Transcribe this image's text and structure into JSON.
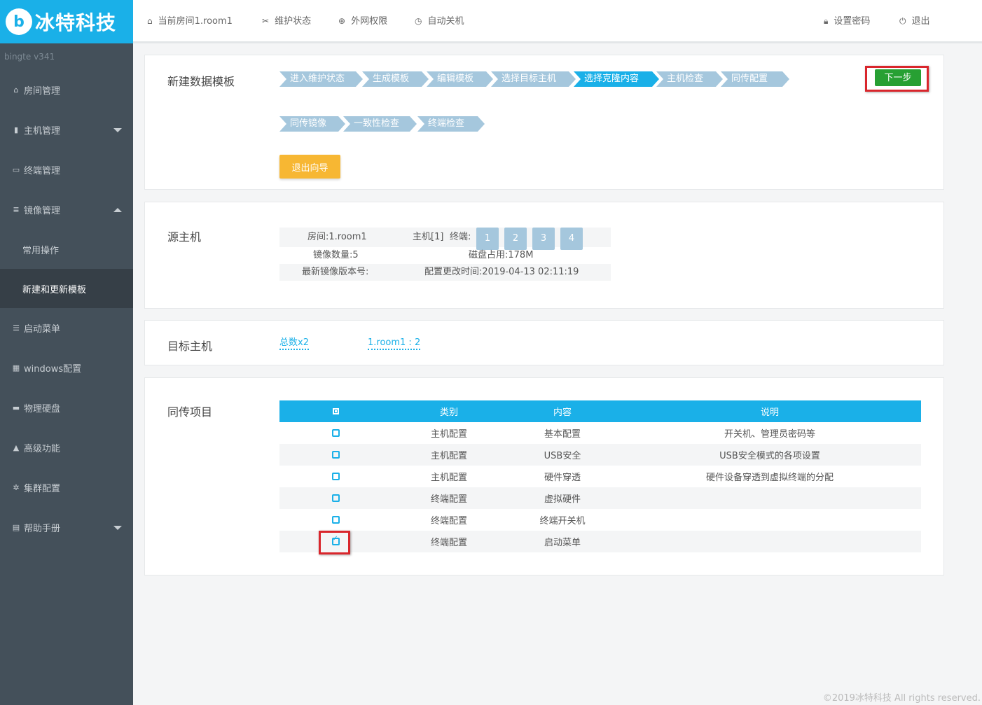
{
  "brand": {
    "logo_letter": "b",
    "name": "冰特科技",
    "version": "bingte  v341",
    "color": "#1ab0e8"
  },
  "sidebar": {
    "items": [
      {
        "label": "房间管理",
        "icon": "home-icon",
        "glyph": "⌂"
      },
      {
        "label": "主机管理",
        "icon": "server-icon",
        "glyph": "▮",
        "caret": "down"
      },
      {
        "label": "终端管理",
        "icon": "monitor-icon",
        "glyph": "▭"
      },
      {
        "label": "镜像管理",
        "icon": "database-icon",
        "glyph": "≣",
        "caret": "up"
      },
      {
        "label": "常用操作",
        "sub": true
      },
      {
        "label": "新建和更新模板",
        "sub": true,
        "active": true
      },
      {
        "label": "启动菜单",
        "icon": "list-icon",
        "glyph": "☰"
      },
      {
        "label": "windows配置",
        "icon": "windows-icon",
        "glyph": "▦"
      },
      {
        "label": "物理硬盘",
        "icon": "hdd-icon",
        "glyph": "▬"
      },
      {
        "label": "高级功能",
        "icon": "warning-icon",
        "glyph": "▲"
      },
      {
        "label": "集群配置",
        "icon": "gear-icon",
        "glyph": "✲"
      },
      {
        "label": "帮助手册",
        "icon": "book-icon",
        "glyph": "▤",
        "caret": "down"
      }
    ]
  },
  "topbar": {
    "room": {
      "label": "当前房间1.room1",
      "glyph": "⌂"
    },
    "maintain": {
      "label": "维护状态",
      "glyph": "✂"
    },
    "network": {
      "label": "外网权限",
      "glyph": "⊕"
    },
    "shutdown": {
      "label": "自动关机",
      "glyph": "◷"
    },
    "password": {
      "label": "设置密码",
      "glyph": "🔒︎"
    },
    "logout": {
      "label": "退出",
      "glyph": "⏻"
    }
  },
  "wizard": {
    "title": "新建数据模板",
    "steps_row1": [
      {
        "label": "进入维护状态",
        "active": false
      },
      {
        "label": "生成模板",
        "active": false
      },
      {
        "label": "编辑模板",
        "active": false
      },
      {
        "label": "选择目标主机",
        "active": false
      },
      {
        "label": "选择克隆内容",
        "active": true
      },
      {
        "label": "主机检查",
        "active": false
      },
      {
        "label": "同传配置",
        "active": false
      }
    ],
    "steps_row2": [
      {
        "label": "同传镜像",
        "active": false
      },
      {
        "label": "一致性检查",
        "active": false
      },
      {
        "label": "终端检查",
        "active": false
      }
    ],
    "next_label": "下一步",
    "exit_label": "退出向导"
  },
  "source": {
    "title": "源主机",
    "room": "房间:1.room1",
    "host": "主机[1]",
    "terminals_label": "终端:",
    "terminals": [
      "1",
      "2",
      "3",
      "4"
    ],
    "image_count": "镜像数量:5",
    "disk_usage": "磁盘占用:178M",
    "latest_version": "最新镜像版本号:",
    "config_time": "配置更改时间:2019-04-13 02:11:19"
  },
  "target": {
    "title": "目标主机",
    "total": "总数x2",
    "room_link": "1.room1 : 2"
  },
  "sync": {
    "title": "同传项目",
    "headers": [
      "类别",
      "内容",
      "说明"
    ],
    "rows": [
      {
        "category": "主机配置",
        "content": "基本配置",
        "desc": "开关机、管理员密码等",
        "checked": false
      },
      {
        "category": "主机配置",
        "content": "USB安全",
        "desc": "USB安全模式的各项设置",
        "checked": false
      },
      {
        "category": "主机配置",
        "content": "硬件穿透",
        "desc": "硬件设备穿透到虚拟终端的分配",
        "checked": false
      },
      {
        "category": "终端配置",
        "content": "虚拟硬件",
        "desc": "",
        "checked": false
      },
      {
        "category": "终端配置",
        "content": "终端开关机",
        "desc": "",
        "checked": false
      },
      {
        "category": "终端配置",
        "content": "启动菜单",
        "desc": "",
        "checked": true
      }
    ]
  },
  "footer": "©2019冰特科技 All rights reserved."
}
